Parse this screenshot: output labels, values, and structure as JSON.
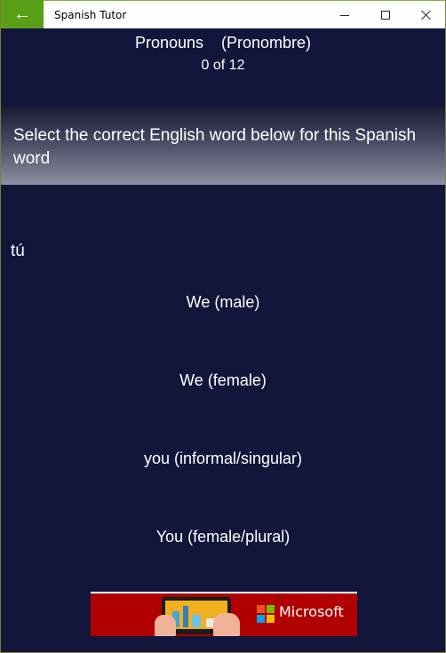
{
  "titlebar": {
    "app_title": "Spanish Tutor",
    "back_icon": "←",
    "controls": [
      "minimize-icon",
      "maximize-icon",
      "close-icon"
    ]
  },
  "header": {
    "title": "Pronouns    (Pronombre)",
    "progress": "0 of 12"
  },
  "instruction": "Select the correct English word below for this Spanish word",
  "question_word": "tú",
  "options": [
    "We (male)",
    "We (female)",
    "you (informal/singular)",
    "You (female/plural)"
  ],
  "ad": {
    "brand": "Microsoft"
  },
  "colors": {
    "background": "#13163b",
    "accent": "#5aa016",
    "ad_background": "#b00000"
  }
}
